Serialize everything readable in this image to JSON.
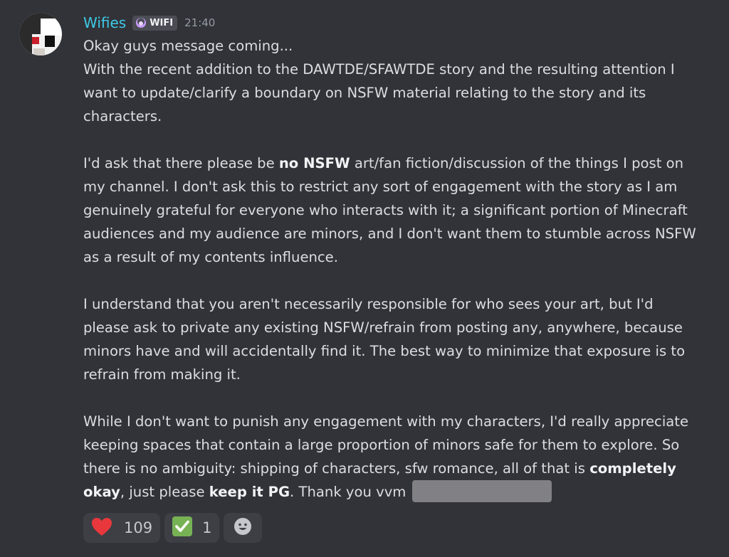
{
  "message": {
    "author": "Wifies",
    "tag": {
      "icon": "moon-badge-icon",
      "label": "WIFI",
      "icon_color": "#c89cff"
    },
    "timestamp": "21:40",
    "lines": {
      "l1": "Okay guys message coming...",
      "l2": "With the recent addition to the DAWTDE/SFAWTDE story and the resulting attention I want to update/clarify a boundary on NSFW material relating to the story and its characters.",
      "p2a": "I'd ask that there please be ",
      "p2b": "no NSFW",
      "p2c": " art/fan fiction/discussion of the things I post on my channel. I don't ask this to restrict any sort of engagement with the story as I am genuinely grateful for everyone who interacts with it; a significant portion of Minecraft audiences and my audience are minors, and I don't want them to stumble across NSFW as a result of my contents influence.",
      "p3": "I understand that you aren't necessarily responsible for who sees your art, but I'd please ask to private any existing NSFW/refrain from posting any, anywhere, because minors have and will accidentally find it. The best way to minimize that exposure is to refrain from making it.",
      "p4a": "While I don't want to punish any engagement with my characters, I'd really appreciate keeping spaces that contain a large proportion of minors safe for them to explore. So there is no ambiguity: shipping of characters, sfw romance, all of that is ",
      "p4b": "completely okay",
      "p4c": ", just please ",
      "p4d": "keep it PG",
      "p4e": ". Thank you vvm"
    }
  },
  "reactions": [
    {
      "emoji": "heart-icon",
      "count": "109",
      "color": "#e8383d"
    },
    {
      "emoji": "check-mark-icon",
      "count": "1",
      "color": "#77b255"
    }
  ],
  "add_reaction": {
    "icon": "smiley-icon"
  },
  "colors": {
    "background": "#313338",
    "username": "#3ec9e6",
    "text": "#dbdee1",
    "timestamp": "#949ba4"
  }
}
